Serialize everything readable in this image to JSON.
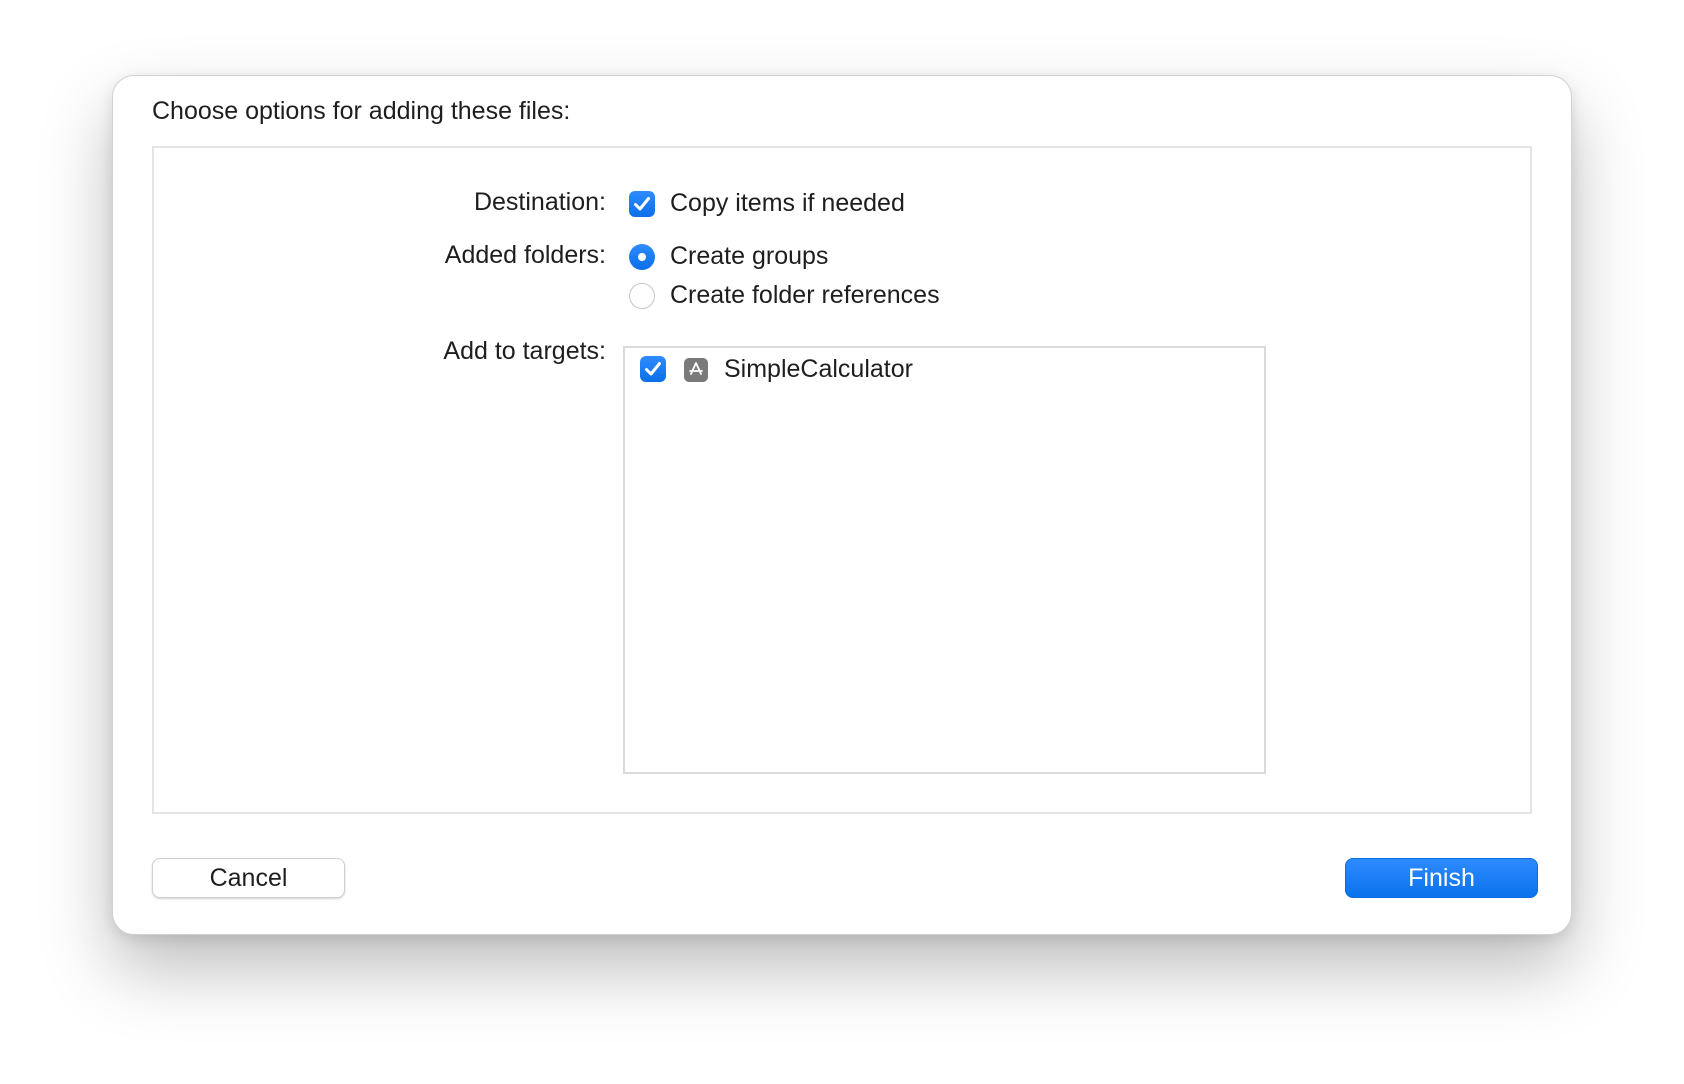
{
  "dialog": {
    "title": "Choose options for adding these files:"
  },
  "destination": {
    "label": "Destination:",
    "copy_items": {
      "label": "Copy items if needed",
      "checked": true
    }
  },
  "added_folders": {
    "label": "Added folders:",
    "options": [
      {
        "label": "Create groups",
        "selected": true
      },
      {
        "label": "Create folder references",
        "selected": false
      }
    ]
  },
  "targets": {
    "label": "Add to targets:",
    "items": [
      {
        "name": "SimpleCalculator",
        "checked": true,
        "icon": "app-store-icon"
      }
    ]
  },
  "buttons": {
    "cancel": "Cancel",
    "finish": "Finish"
  },
  "colors": {
    "accent": "#0a72ec"
  }
}
